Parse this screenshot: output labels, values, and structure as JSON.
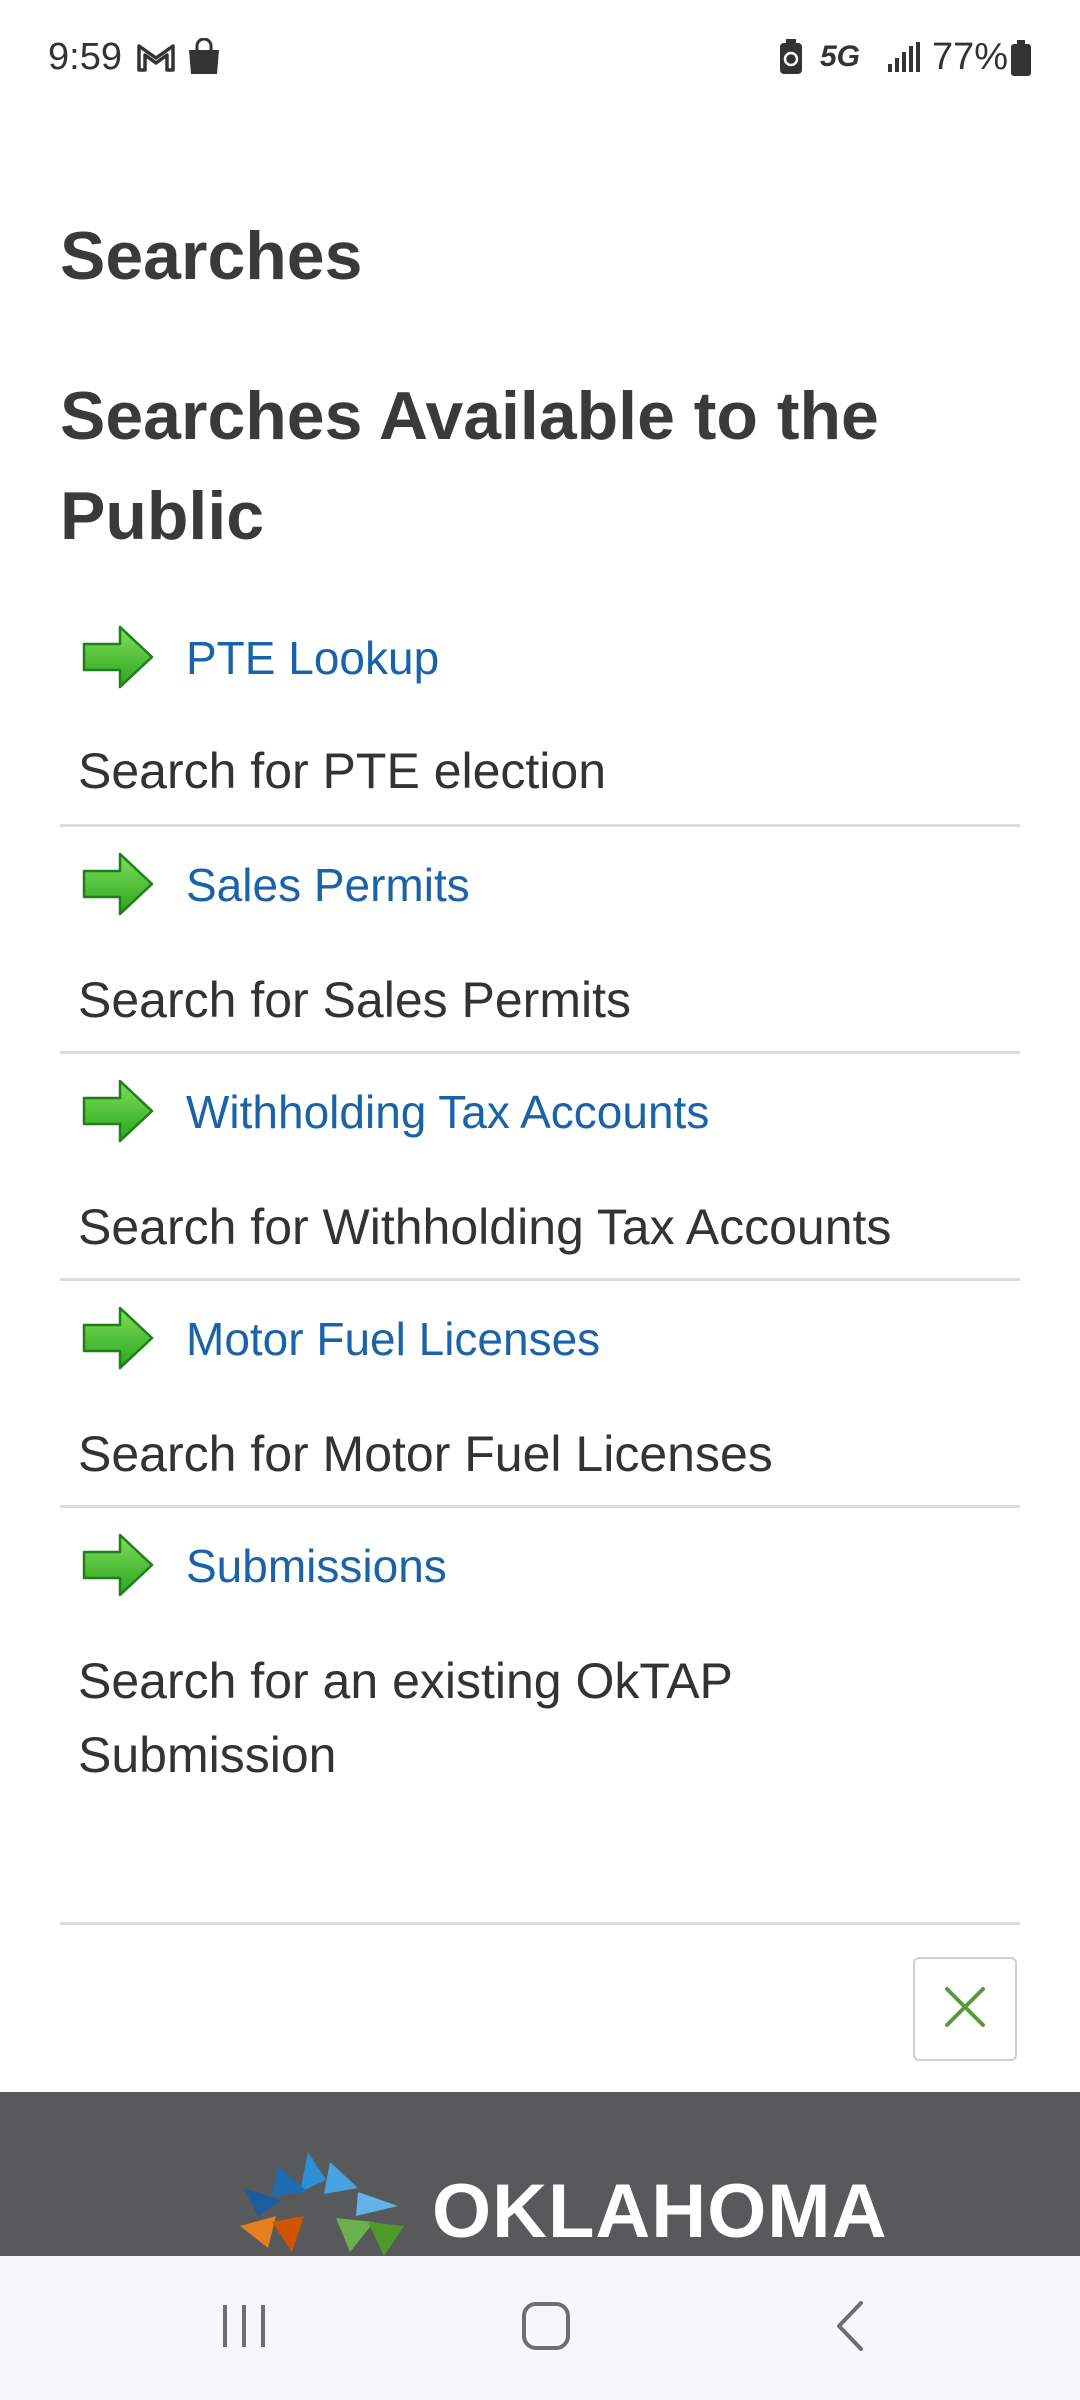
{
  "status_bar": {
    "time": "9:59",
    "network": "5G",
    "battery": "77%",
    "icons": [
      "gmail-icon",
      "shopping-bag-icon",
      "battery-saver-icon",
      "signal-icon",
      "battery-icon"
    ]
  },
  "page": {
    "title": "Searches",
    "section_title": "Searches Available to the Public"
  },
  "searches": [
    {
      "link": "PTE Lookup",
      "description": "Search for PTE election",
      "icon": "green-arrow-icon"
    },
    {
      "link": "Sales Permits",
      "description": "Search for Sales Permits",
      "icon": "green-arrow-icon"
    },
    {
      "link": "Withholding Tax Accounts",
      "description": "Search for Withholding Tax Accounts",
      "icon": "green-arrow-icon"
    },
    {
      "link": "Motor Fuel Licenses",
      "description": "Search for Motor Fuel Licenses",
      "icon": "green-arrow-icon"
    },
    {
      "link": "Submissions",
      "description": "Search for an existing OkTAP Submission",
      "icon": "green-arrow-icon"
    }
  ],
  "close_button": {
    "icon": "close-icon"
  },
  "footer": {
    "brand": "OKLAHOMA"
  },
  "colors": {
    "link": "#1a63a8",
    "arrow": "#3cb82e",
    "footer_bg": "#58595b",
    "close_x": "#5b9a3c"
  },
  "nav_bar": {
    "buttons": [
      "recent-apps-icon",
      "home-icon",
      "back-icon"
    ]
  }
}
